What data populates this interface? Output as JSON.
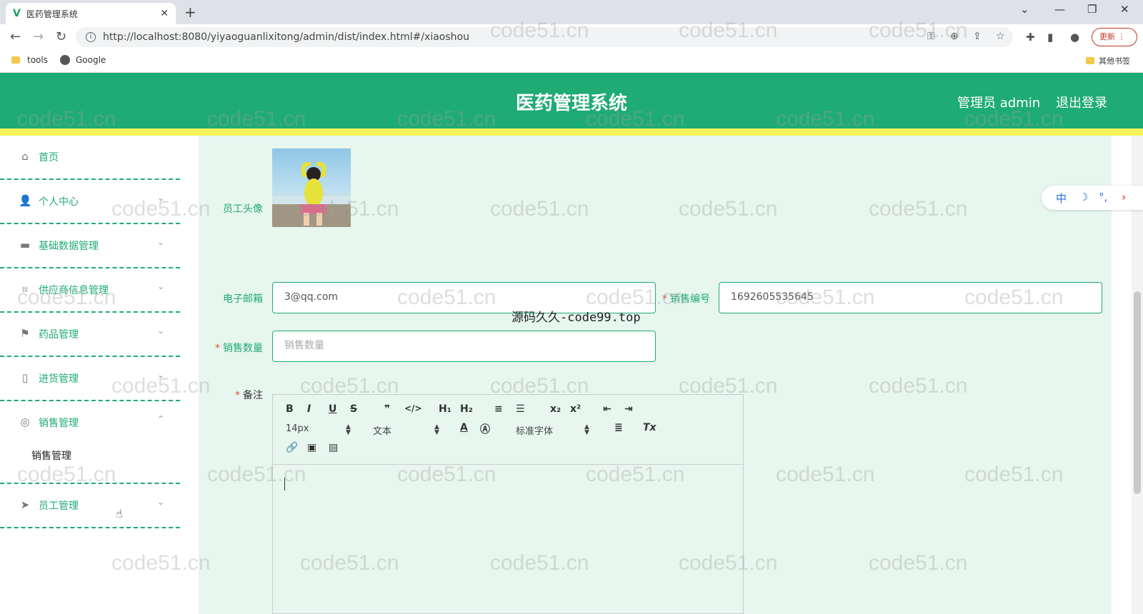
{
  "browser": {
    "tab_title": "医药管理系统",
    "tab_favicon": "V",
    "new_tab": "+",
    "url": "http://localhost:8080/yiyaoguanlixitong/admin/dist/index.html#/xiaoshou",
    "update_label": "更新",
    "bookmarks": [
      "tools",
      "Google"
    ],
    "other_bookmarks": "其他书签"
  },
  "header": {
    "title": "医药管理系统",
    "user": "管理员 admin",
    "logout": "退出登录"
  },
  "sidebar": {
    "items": [
      {
        "label": "首页",
        "icon": "home-icon",
        "has_chevron": false
      },
      {
        "label": "个人中心",
        "icon": "user-icon",
        "has_chevron": true
      },
      {
        "label": "基础数据管理",
        "icon": "monitor-icon",
        "has_chevron": true
      },
      {
        "label": "供应商信息管理",
        "icon": "crop-icon",
        "has_chevron": true
      },
      {
        "label": "药品管理",
        "icon": "flag-icon",
        "has_chevron": true
      },
      {
        "label": "进货管理",
        "icon": "phone-icon",
        "has_chevron": true
      },
      {
        "label": "销售管理",
        "icon": "circle-icon",
        "has_chevron": true,
        "expanded": true
      },
      {
        "label": "员工管理",
        "icon": "send-icon",
        "has_chevron": true
      }
    ],
    "sub_item": "销售管理"
  },
  "form": {
    "avatar_label": "员工头像",
    "email_label": "电子邮箱",
    "email_value": "3@qq.com",
    "sale_no_label": "销售编号",
    "sale_no_value": "1692605535645",
    "quantity_label": "销售数量",
    "quantity_placeholder": "销售数量",
    "note_label": "备注",
    "required_mark": "*"
  },
  "editor": {
    "font_size": "14px",
    "block_type": "文本",
    "font_family": "标准字体",
    "buttons": [
      "B",
      "I",
      "U",
      "S",
      "❞",
      "</>",
      "H₁",
      "H₂",
      "≡",
      "☰",
      "x₂",
      "x²",
      "⇤",
      "⇥",
      "A",
      "Ⓐ",
      "≣",
      "Tx",
      "🔗",
      "▣",
      "▤"
    ]
  },
  "float_toolbar": [
    "中",
    "☽",
    "°,",
    "›"
  ],
  "overlay_text": "源码久久-code99.top",
  "watermark": "code51.cn",
  "colors": {
    "primary": "#1fab74",
    "yellow": "#f6f45a",
    "bg": "#e7f6ef"
  }
}
